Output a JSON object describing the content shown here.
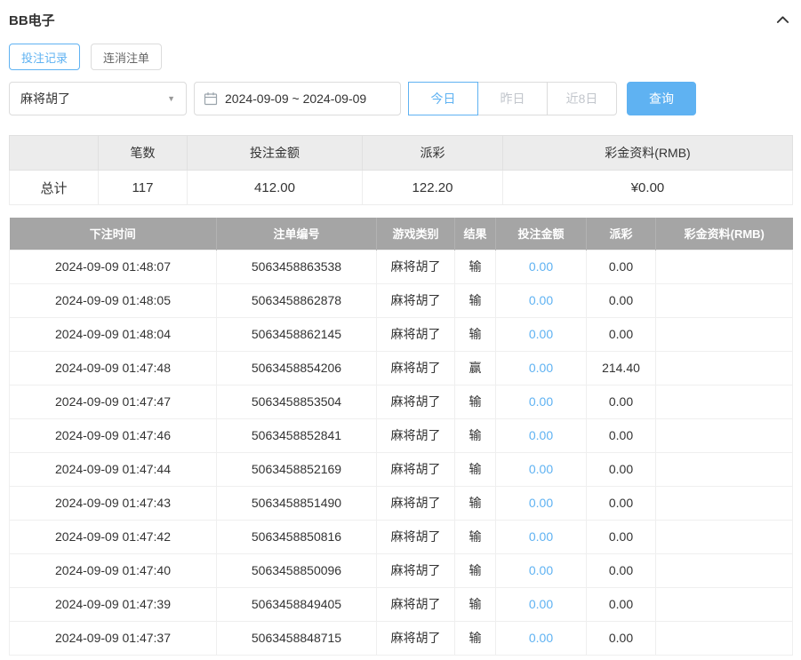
{
  "header": {
    "title": "BB电子"
  },
  "tabs": [
    {
      "label": "投注记录",
      "active": true
    },
    {
      "label": "连消注单",
      "active": false
    }
  ],
  "filters": {
    "game_select_value": "麻将胡了",
    "date_range_value": "2024-09-09 ~ 2024-09-09",
    "quick_buttons": [
      {
        "label": "今日",
        "active": true
      },
      {
        "label": "昨日",
        "active": false
      },
      {
        "label": "近8日",
        "active": false
      }
    ],
    "search_label": "查询"
  },
  "summary": {
    "headers": [
      "",
      "笔数",
      "投注金额",
      "派彩",
      "彩金资料(RMB)"
    ],
    "total": {
      "label": "总计",
      "count": "117",
      "bet_amount": "412.00",
      "payout": "122.20",
      "bonus": "¥0.00"
    }
  },
  "table": {
    "headers": [
      "下注时间",
      "注单编号",
      "游戏类别",
      "结果",
      "投注金额",
      "派彩",
      "彩金资料(RMB)"
    ],
    "rows": [
      {
        "time": "2024-09-09 01:48:07",
        "order_no": "5063458863538",
        "game": "麻将胡了",
        "result": "输",
        "bet": "0.00",
        "payout": "0.00",
        "bonus": ""
      },
      {
        "time": "2024-09-09 01:48:05",
        "order_no": "5063458862878",
        "game": "麻将胡了",
        "result": "输",
        "bet": "0.00",
        "payout": "0.00",
        "bonus": ""
      },
      {
        "time": "2024-09-09 01:48:04",
        "order_no": "5063458862145",
        "game": "麻将胡了",
        "result": "输",
        "bet": "0.00",
        "payout": "0.00",
        "bonus": ""
      },
      {
        "time": "2024-09-09 01:47:48",
        "order_no": "5063458854206",
        "game": "麻将胡了",
        "result": "赢",
        "bet": "0.00",
        "payout": "214.40",
        "bonus": ""
      },
      {
        "time": "2024-09-09 01:47:47",
        "order_no": "5063458853504",
        "game": "麻将胡了",
        "result": "输",
        "bet": "0.00",
        "payout": "0.00",
        "bonus": ""
      },
      {
        "time": "2024-09-09 01:47:46",
        "order_no": "5063458852841",
        "game": "麻将胡了",
        "result": "输",
        "bet": "0.00",
        "payout": "0.00",
        "bonus": ""
      },
      {
        "time": "2024-09-09 01:47:44",
        "order_no": "5063458852169",
        "game": "麻将胡了",
        "result": "输",
        "bet": "0.00",
        "payout": "0.00",
        "bonus": ""
      },
      {
        "time": "2024-09-09 01:47:43",
        "order_no": "5063458851490",
        "game": "麻将胡了",
        "result": "输",
        "bet": "0.00",
        "payout": "0.00",
        "bonus": ""
      },
      {
        "time": "2024-09-09 01:47:42",
        "order_no": "5063458850816",
        "game": "麻将胡了",
        "result": "输",
        "bet": "0.00",
        "payout": "0.00",
        "bonus": ""
      },
      {
        "time": "2024-09-09 01:47:40",
        "order_no": "5063458850096",
        "game": "麻将胡了",
        "result": "输",
        "bet": "0.00",
        "payout": "0.00",
        "bonus": ""
      },
      {
        "time": "2024-09-09 01:47:39",
        "order_no": "5063458849405",
        "game": "麻将胡了",
        "result": "输",
        "bet": "0.00",
        "payout": "0.00",
        "bonus": ""
      },
      {
        "time": "2024-09-09 01:47:37",
        "order_no": "5063458848715",
        "game": "麻将胡了",
        "result": "输",
        "bet": "0.00",
        "payout": "0.00",
        "bonus": ""
      }
    ]
  },
  "colors": {
    "accent": "#5fb2f2",
    "link": "#5fb2f2",
    "table_header_bg": "#a5a5a5",
    "summary_header_bg": "#ececec"
  }
}
